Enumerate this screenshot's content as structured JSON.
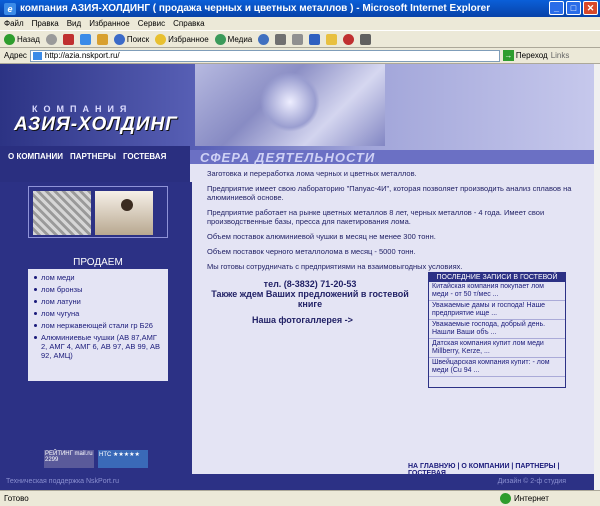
{
  "window": {
    "title": "компания АЗИЯ-ХОЛДИНГ ( продажа черных и цветных металлов ) - Microsoft Internet Explorer",
    "minimize": "_",
    "maximize": "□",
    "close": "✕"
  },
  "menu": [
    "Файл",
    "Правка",
    "Вид",
    "Избранное",
    "Сервис",
    "Справка"
  ],
  "toolbar": {
    "back": "Назад",
    "search": "Поиск",
    "favorites": "Избранное",
    "media": "Медиа"
  },
  "address": {
    "label": "Адрес",
    "url": "http://azia.nskport.ru/",
    "go": "Переход",
    "links": "Links"
  },
  "site": {
    "logo_small": "КОМПАНИЯ",
    "logo_main": "АЗИЯ-ХОЛДИНГ",
    "nav": [
      "О КОМПАНИИ",
      "ПАРТНЕРЫ",
      "ГОСТЕВАЯ"
    ],
    "section_title": "СФЕРА ДЕЯТЕЛЬНОСТИ",
    "paragraphs": [
      "Заготовка и переработка лома черных и цветных металлов.",
      "Предприятие имеет свою лабораторию \"Папуас-4И\", которая позволяет производить анализ сплавов на алюминиевой основе.",
      "Предприятие работает на рынке цветных металлов 8 лет, черных металлов - 4 года. Имеет свои производственные базы, пресса для пакетирования лома.",
      "Объем поставок алюминиевой чушки в месяц не менее 300 тонн.",
      "Объем поставок черного металлолома в месяц - 5000 тонн.",
      "Мы готовы сотрудничать с предприятиями на взаимовыгодных условиях."
    ],
    "sells": {
      "title": "ПРОДАЕМ",
      "items": [
        "лом меди",
        "лом бронзы",
        "лом латуни",
        "лом чугуна",
        "лом нержавеющей стали гр Б26",
        "Алюминиевые чушки (АВ 87,АМГ 2, АМГ 4, АМГ 6, АВ 97, АВ 99, АВ 92, АМЦ)"
      ]
    },
    "phone": "тел. (8-3832) 71-20-53",
    "phone_note": "Также ждем Ваших предложений в гостевой книге",
    "photos_link": "Наша фотогаллерея ->",
    "guestbook": {
      "title": "ПОСЛЕДНИЕ ЗАПИСИ В ГОСТЕВОЙ",
      "items": [
        "Китайская компания покупает лом меди - от 50 т/мес ...",
        "Уважаемые дамы и господа! Наше предприятие ище ...",
        "Уважаемые господа, добрый день. Нашли Ваши объ ...",
        "Датская компания купит лом меди Millberry, Kerze, ...",
        "Швейцарская компания купит: - лом меди (Cu 94 ..."
      ]
    },
    "footer_links": "НА ГЛАВНУЮ | О КОМПАНИИ | ПАРТНЕРЫ | ГОСТЕВАЯ",
    "footer_left": "Техническая поддержка NskPort.ru",
    "footer_right": "Дизайн © 2-ф студия",
    "counter1": "РЕЙТИНГ mail.ru",
    "counter1_value": "2299",
    "counter2": "HTC ★★★★★"
  },
  "status": {
    "text": "Готово",
    "zone": "Интернет"
  }
}
